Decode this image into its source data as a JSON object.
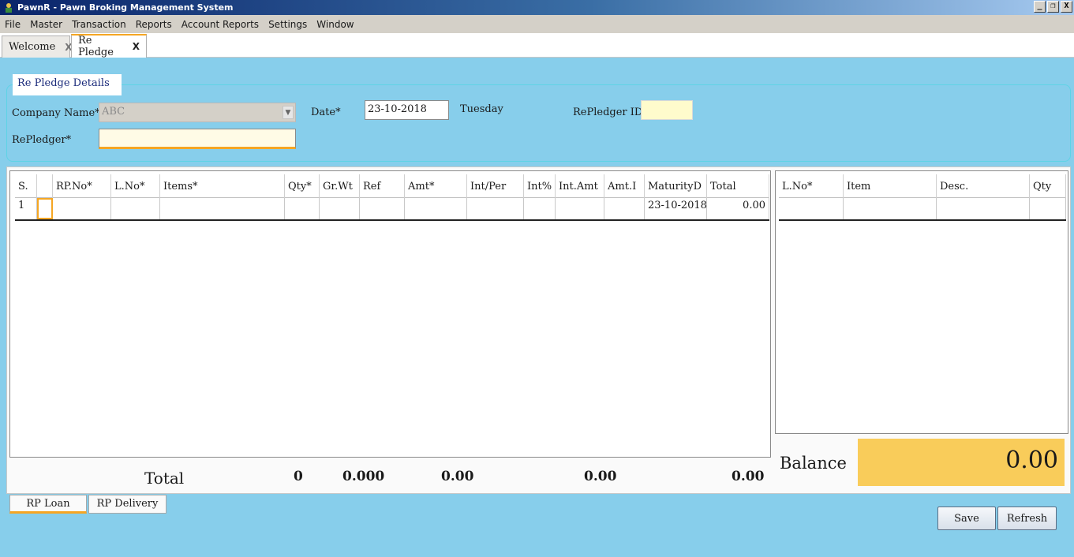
{
  "window": {
    "title": "PawnR - Pawn Broking Management System",
    "min": "_",
    "restore": "❐",
    "close": "X"
  },
  "menu": [
    "File",
    "Master",
    "Transaction",
    "Reports",
    "Account Reports",
    "Settings",
    "Window"
  ],
  "tabs": [
    {
      "label": "Welcome",
      "close": "X"
    },
    {
      "label": "Re Pledge",
      "close": "X"
    }
  ],
  "details": {
    "caption": "Re Pledge Details",
    "company_label": "Company Name*",
    "company_value": "ABC",
    "date_label": "Date*",
    "date_value": "23-10-2018",
    "day": "Tuesday",
    "repledger_id_label": "RePledger ID",
    "repledger_label": "RePledger*",
    "repledger_value": ""
  },
  "grid1": {
    "headers": [
      "S.",
      "",
      "RP.No*",
      "L.No*",
      "Items*",
      "Qty*",
      "Gr.Wt",
      "Ref",
      "Amt*",
      "Int/Per",
      "Int%",
      "Int.Amt",
      "Amt.I",
      "MaturityD",
      "Total"
    ],
    "row": [
      "1",
      "",
      "",
      "",
      "",
      "",
      "",
      "",
      "",
      "",
      "",
      "",
      "",
      "23-10-2018",
      "0.00"
    ]
  },
  "grid2": {
    "headers": [
      "L.No*",
      "Item",
      "Desc.",
      "Qty"
    ],
    "row": [
      "",
      "",
      "",
      ""
    ]
  },
  "totals": {
    "label": "Total",
    "qty": "0",
    "grwt": "0.000",
    "amt": "0.00",
    "intamt": "0.00",
    "total": "0.00"
  },
  "balance": {
    "label": "Balance",
    "value": "0.00"
  },
  "bottom_tabs": [
    "RP Loan",
    "RP Delivery"
  ],
  "buttons": {
    "save": "Save",
    "refresh": "Refresh"
  },
  "colors": {
    "background": "#87ceeb",
    "balance": "#f9cc5a",
    "accent": "#f5a623",
    "id_field": "#fffbcc"
  }
}
